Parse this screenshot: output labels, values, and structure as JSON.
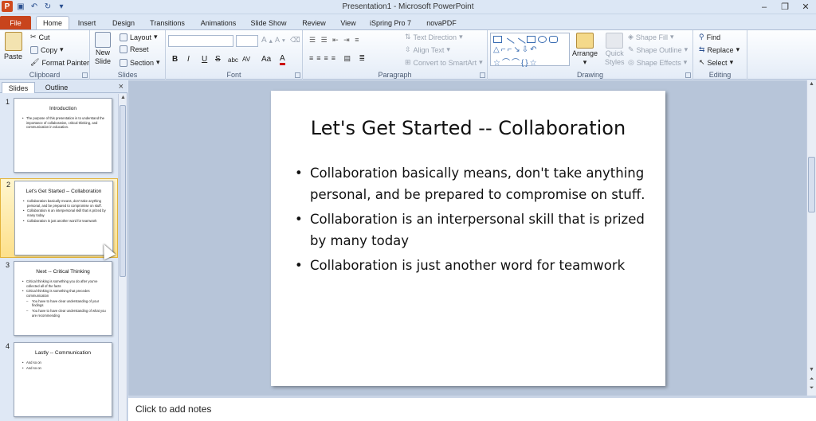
{
  "window": {
    "title": "Presentation1 - Microsoft PowerPoint",
    "app_icon": "P"
  },
  "tabs": [
    "File",
    "Home",
    "Insert",
    "Design",
    "Transitions",
    "Animations",
    "Slide Show",
    "Review",
    "View",
    "iSpring Pro 7",
    "novaPDF"
  ],
  "ribbon": {
    "clipboard": {
      "paste": "Paste",
      "cut": "Cut",
      "copy": "Copy",
      "format_painter": "Format Painter",
      "label": "Clipboard"
    },
    "slides": {
      "new_slide_1": "New",
      "new_slide_2": "Slide",
      "layout": "Layout",
      "reset": "Reset",
      "section": "Section",
      "label": "Slides"
    },
    "font": {
      "label": "Font",
      "bold": "B",
      "italic": "I",
      "underline": "U",
      "strike": "S",
      "shadow": "abc",
      "spacing": "AV",
      "case": "Aa",
      "color": "A"
    },
    "paragraph": {
      "text_direction": "Text Direction",
      "align_text": "Align Text",
      "smartart": "Convert to SmartArt",
      "label": "Paragraph"
    },
    "drawing": {
      "arrange": "Arrange",
      "quick_styles_1": "Quick",
      "quick_styles_2": "Styles",
      "shape_fill": "Shape Fill",
      "shape_outline": "Shape Outline",
      "shape_effects": "Shape Effects",
      "label": "Drawing"
    },
    "editing": {
      "find": "Find",
      "replace": "Replace",
      "select": "Select",
      "label": "Editing"
    }
  },
  "panel": {
    "tab_slides": "Slides",
    "tab_outline": "Outline",
    "close": "×"
  },
  "thumbnails": [
    {
      "num": "1",
      "title": "Introduction",
      "bullets": [
        "The purpose of this presentation is to understand the importance of collaboration, critical thinking, and communication in education."
      ]
    },
    {
      "num": "2",
      "title": "Let's Get Started -- Collaboration",
      "bullets": [
        "Collaboration basically means, don't take anything personal, and be prepared to compromise on stuff.",
        "Collaboration is an interpersonal skill that is prized by many today",
        "Collaboration is just another word for teamwork"
      ]
    },
    {
      "num": "3",
      "title": "Next -- Critical Thinking",
      "bullets": [
        "Critical thinking is something you do after you've collected all of the facts",
        "Critical thinking is something that precedes communication"
      ],
      "subbullets": [
        "You have to have clear understanding of your findings",
        "You have to have clear understanding of what you are recommending"
      ]
    },
    {
      "num": "4",
      "title": "Lastly -- Communication",
      "bullets": [
        "And so on",
        "And so on"
      ]
    }
  ],
  "slide": {
    "title": "Let's Get Started -- Collaboration",
    "bullets": [
      "Collaboration basically means, don't take anything personal, and be prepared to compromise on stuff.",
      "Collaboration is an interpersonal skill that is prized by many today",
      "Collaboration is just another word for teamwork"
    ]
  },
  "notes": {
    "placeholder": "Click to add notes"
  }
}
